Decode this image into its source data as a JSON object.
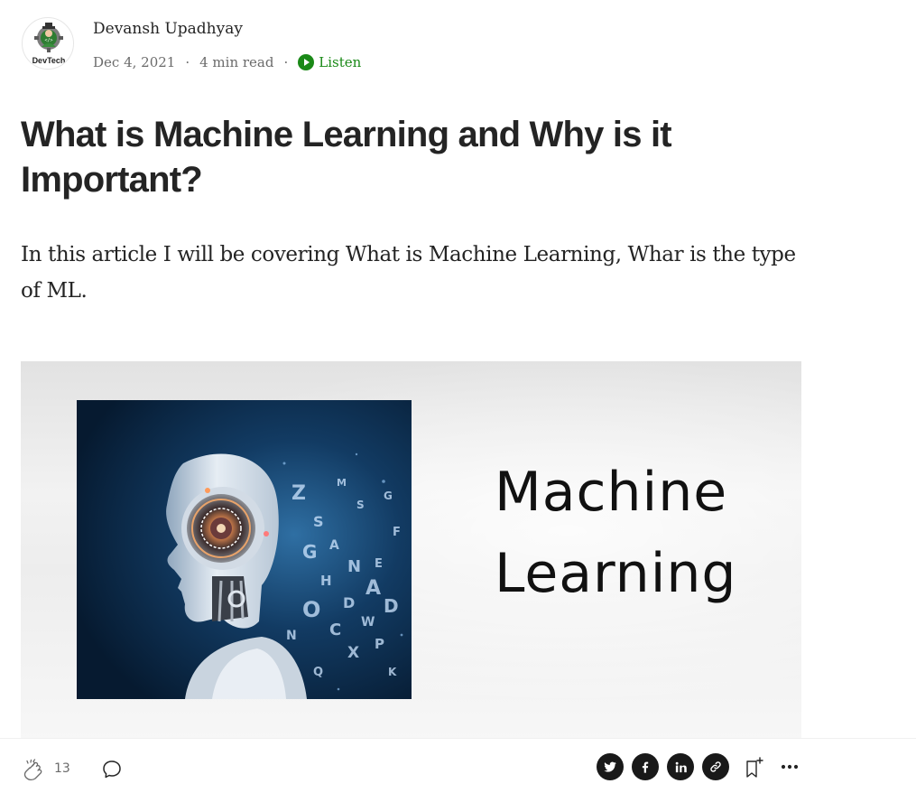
{
  "author": {
    "name": "Devansh Upadhyay",
    "avatar_label": "DevTech"
  },
  "meta": {
    "date": "Dec 4, 2021",
    "read_time": "4 min read",
    "separator": "·",
    "listen_label": "Listen"
  },
  "article": {
    "title": "What is Machine Learning and Why is it Important?",
    "subtitle": "In this article I will be covering What is Machine Learning, Whar is the type of ML."
  },
  "hero_image": {
    "caption_line1": "Machine",
    "caption_line2": "Learning"
  },
  "actions": {
    "clap_count": "13"
  },
  "colors": {
    "accent_green": "#1a8917",
    "text_primary": "#242424",
    "text_secondary": "#6b6b6b",
    "share_button_bg": "#191919"
  },
  "icons": [
    "clap-icon",
    "comment-icon",
    "twitter-icon",
    "facebook-icon",
    "linkedin-icon",
    "link-icon",
    "bookmark-add-icon",
    "more-icon",
    "play-icon"
  ]
}
